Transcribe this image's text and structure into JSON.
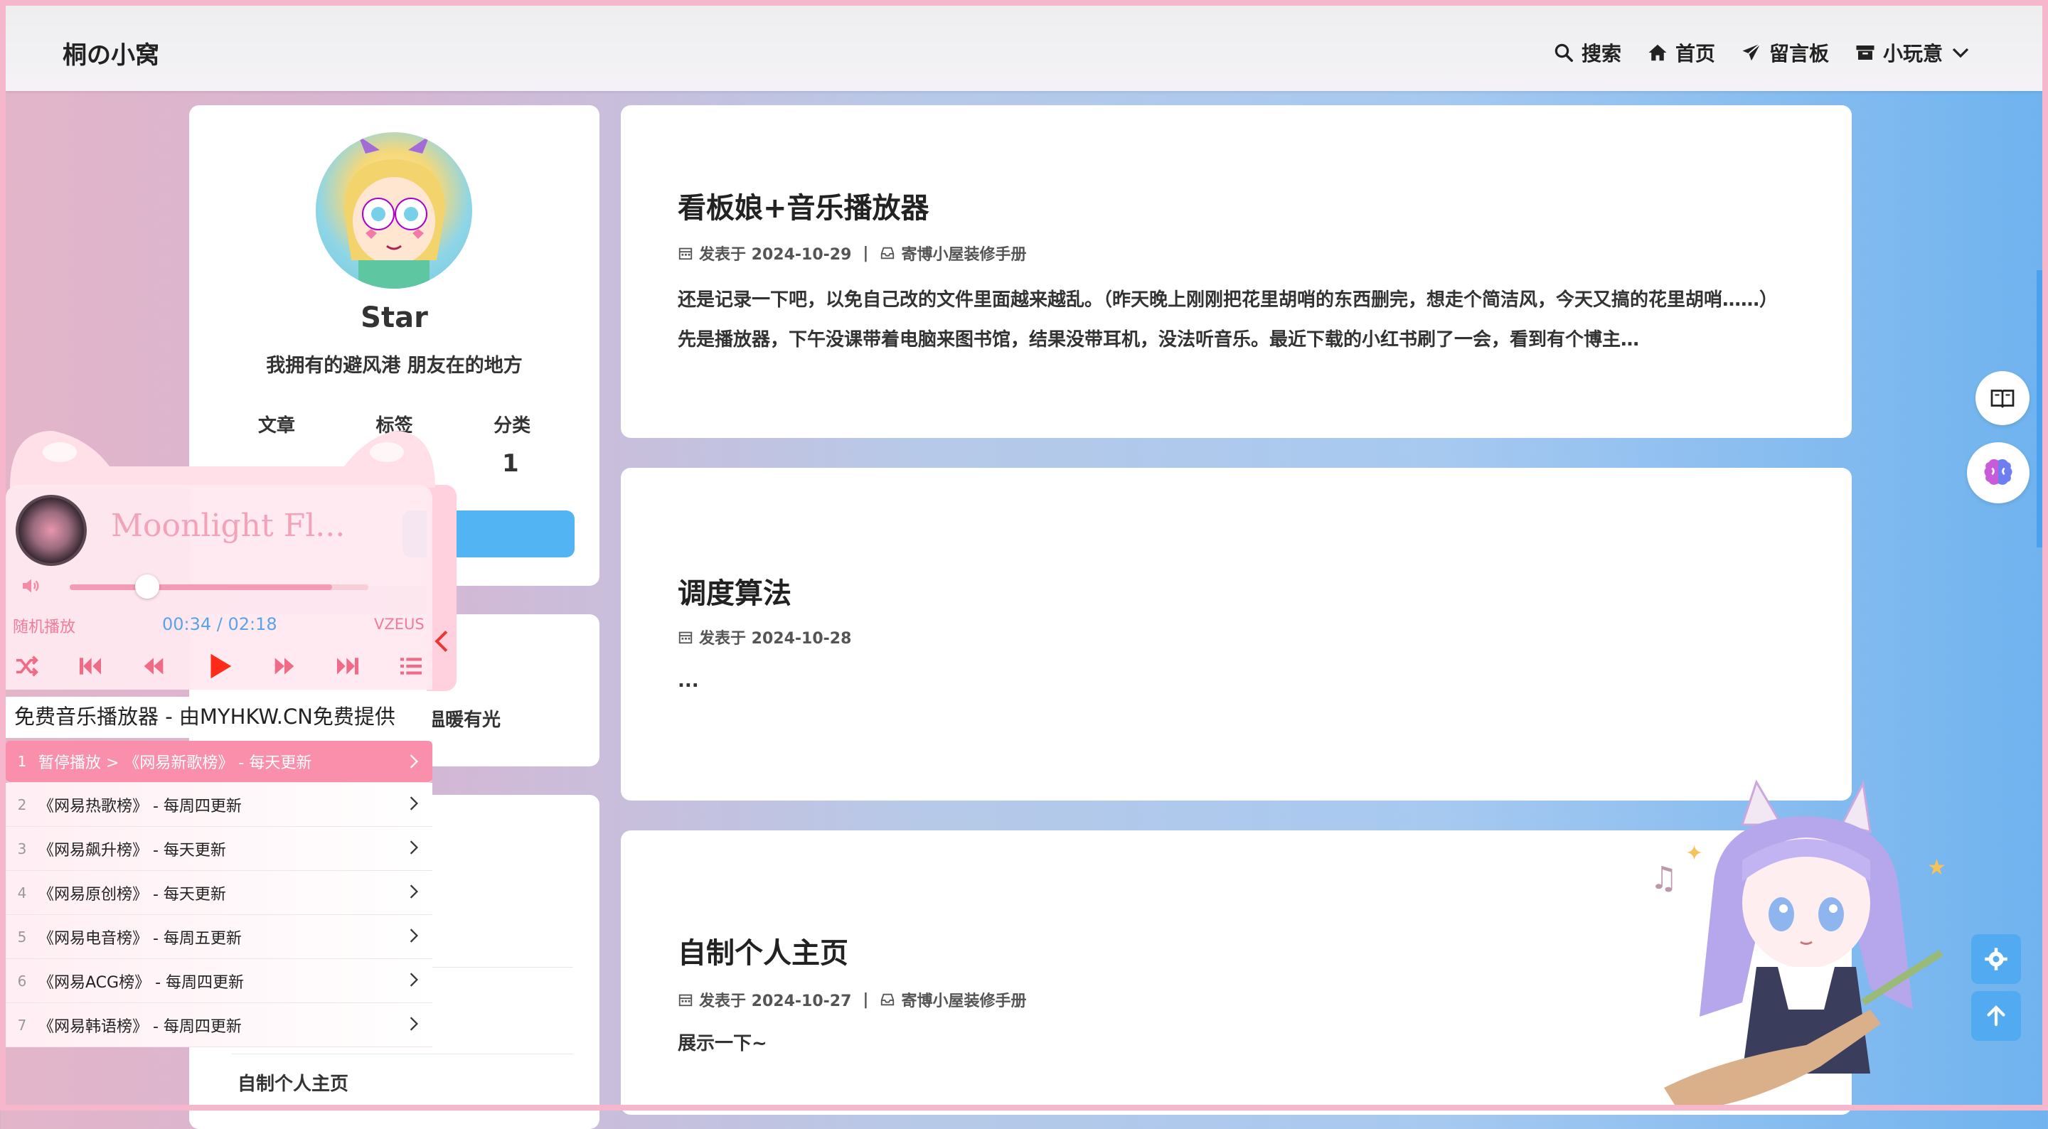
{
  "site": {
    "brand": "桐の小窝"
  },
  "nav": [
    {
      "label": "搜索",
      "icon": "search-icon"
    },
    {
      "label": "首页",
      "icon": "home-icon"
    },
    {
      "label": "留言板",
      "icon": "paper-plane-icon"
    },
    {
      "label": "小玩意",
      "icon": "archive-icon",
      "dropdown": true
    }
  ],
  "profile": {
    "name": "Star",
    "motto": "我拥有的避风港 朋友在的地方",
    "stats": [
      {
        "label": "文章"
      },
      {
        "label": "标签"
      },
      {
        "label": "分类"
      }
    ],
    "category_count": "1"
  },
  "sidebar": {
    "card2_text": "温暖有光",
    "card3_item": "自制个人主页"
  },
  "posts": [
    {
      "title": "看板娘+音乐播放器",
      "date": "发表于 2024-10-29",
      "category": "寄博小屋装修手册",
      "excerpt": "还是记录一下吧，以免自己改的文件里面越来越乱。（昨天晚上刚刚把花里胡哨的东西删完，想走个简洁风，今天又搞的花里胡哨……） 先是播放器，下午没课带着电脑来图书馆，结果没带耳机，没法听音乐。最近下载的小红书刷了一会，看到有个博主…"
    },
    {
      "title": "调度算法",
      "date": "发表于 2024-10-28",
      "category": "",
      "excerpt": "..."
    },
    {
      "title": "自制个人主页",
      "date": "发表于 2024-10-27",
      "category": "寄博小屋装修手册",
      "excerpt": "展示一下~"
    }
  ],
  "player": {
    "song_title": "Moonlight Fl...",
    "mode": "随机播放",
    "time": "00:34 / 02:18",
    "brand": "VZEUS",
    "volume": 0.26,
    "free_text": "免费音乐播放器 - 由MYHKW.CN免费提供",
    "playlist": [
      {
        "num": "1",
        "label": "暂停播放 > 《网易新歌榜》 - 每天更新",
        "active": true
      },
      {
        "num": "2",
        "label": "《网易热歌榜》 - 每周四更新"
      },
      {
        "num": "3",
        "label": "《网易飙升榜》 - 每天更新"
      },
      {
        "num": "4",
        "label": "《网易原创榜》 - 每天更新"
      },
      {
        "num": "5",
        "label": "《网易电音榜》 - 每周五更新"
      },
      {
        "num": "6",
        "label": "《网易ACG榜》 - 每周四更新"
      },
      {
        "num": "7",
        "label": "《网易韩语榜》 - 每周四更新"
      }
    ]
  },
  "colors": {
    "accent": "#52b4f3",
    "player_pink": "#f98fab",
    "frame": "#f6b6cb"
  }
}
